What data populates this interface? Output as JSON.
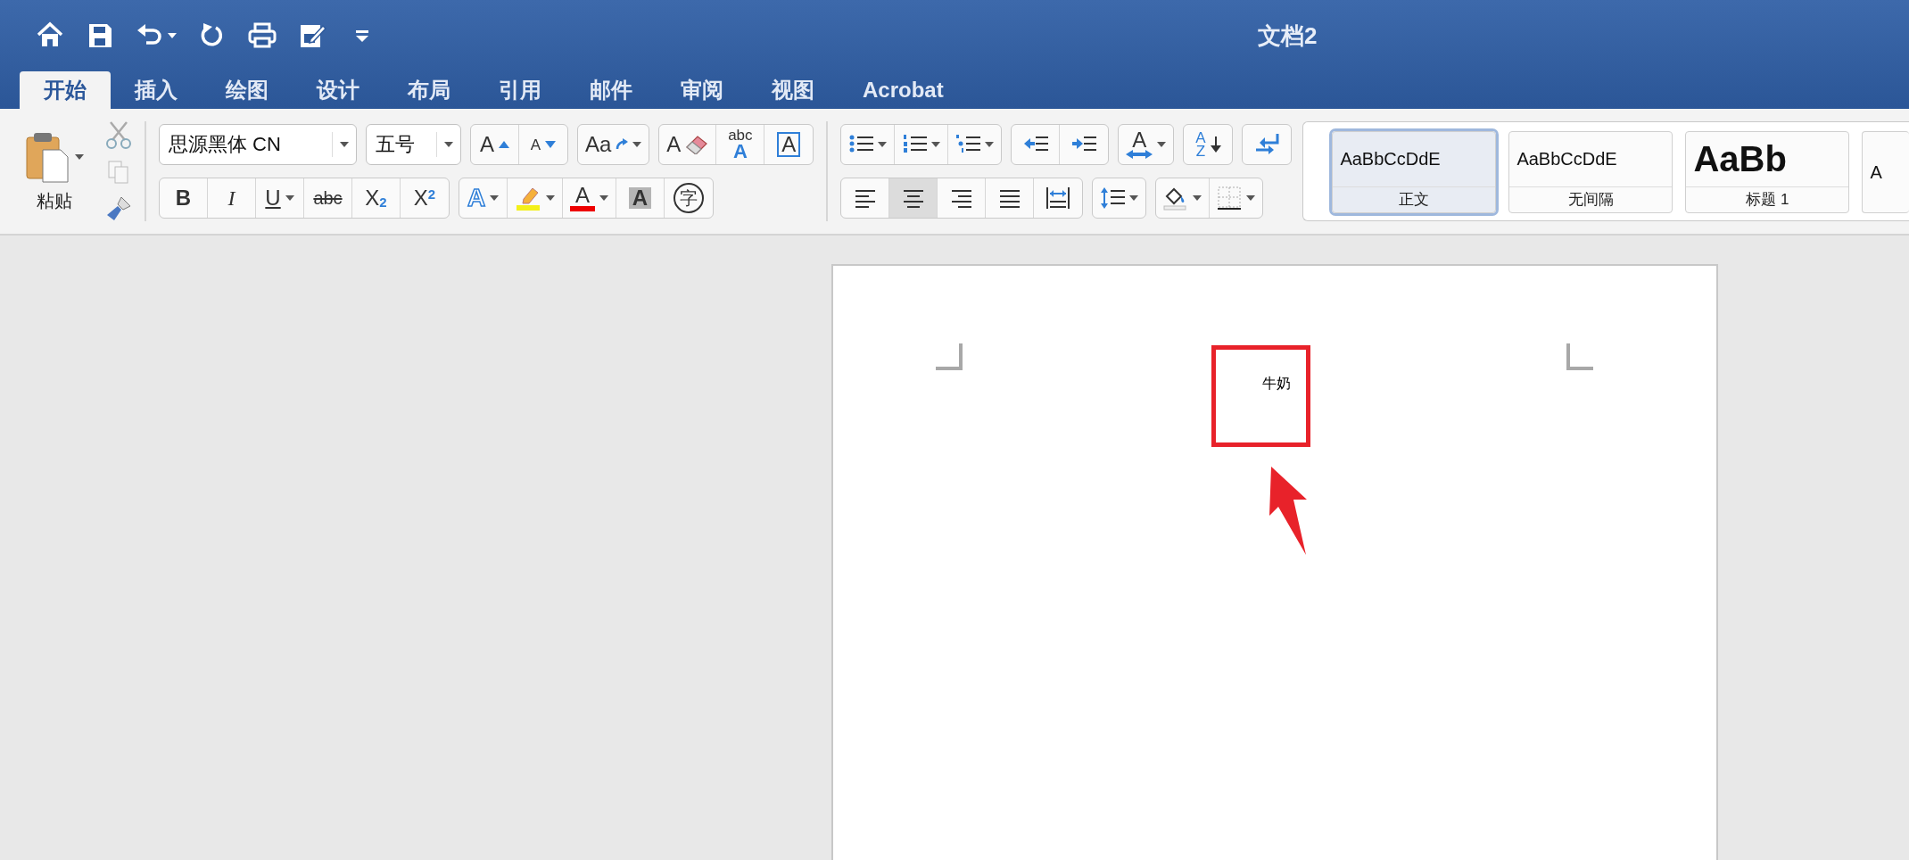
{
  "window": {
    "title": "文档2"
  },
  "quick_access": [
    {
      "kind": "home"
    },
    {
      "kind": "save"
    },
    {
      "kind": "undo",
      "dropdown": true
    },
    {
      "kind": "redo"
    },
    {
      "kind": "print"
    },
    {
      "kind": "edit-document"
    },
    {
      "kind": "customize"
    }
  ],
  "tabs": [
    {
      "label": "开始",
      "selected": true
    },
    {
      "label": "插入",
      "selected": false
    },
    {
      "label": "绘图",
      "selected": false
    },
    {
      "label": "设计",
      "selected": false
    },
    {
      "label": "布局",
      "selected": false
    },
    {
      "label": "引用",
      "selected": false
    },
    {
      "label": "邮件",
      "selected": false
    },
    {
      "label": "审阅",
      "selected": false
    },
    {
      "label": "视图",
      "selected": false
    },
    {
      "label": "Acrobat",
      "selected": false
    }
  ],
  "clipboard": {
    "paste_label": "粘贴"
  },
  "font": {
    "family": "思源黑体 CN",
    "size": "五号",
    "row1": [
      [
        {
          "kind": "grow",
          "label": "A"
        },
        {
          "kind": "shrink",
          "label": "A"
        }
      ],
      [
        {
          "kind": "change-case",
          "label": "Aa",
          "dropdown": true
        }
      ],
      [
        {
          "kind": "clear",
          "label": "A"
        },
        {
          "kind": "phonetic",
          "label": "abc",
          "index": "A"
        },
        {
          "kind": "border",
          "label": "A"
        }
      ]
    ],
    "row2": [
      [
        {
          "kind": "bold",
          "label": "B"
        },
        {
          "kind": "italic",
          "label": "I"
        },
        {
          "kind": "underline",
          "label": "U",
          "dropdown": true
        },
        {
          "kind": "strike",
          "label": "abc"
        },
        {
          "kind": "subscript",
          "label": "X",
          "index": "2"
        },
        {
          "kind": "superscript",
          "label": "X",
          "index": "2"
        }
      ],
      [
        {
          "kind": "effects",
          "label": "A",
          "dropdown": true
        },
        {
          "kind": "highlight",
          "dropdown": true
        },
        {
          "kind": "font-color",
          "label": "A",
          "dropdown": true
        },
        {
          "kind": "shading",
          "label": "A"
        },
        {
          "kind": "enclose",
          "label": "字"
        }
      ]
    ]
  },
  "paragraph": {
    "row1": [
      [
        {
          "kind": "bullets",
          "dropdown": true
        },
        {
          "kind": "numbering",
          "dropdown": true
        },
        {
          "kind": "multilevel",
          "dropdown": true
        }
      ],
      [
        {
          "kind": "outdent"
        },
        {
          "kind": "indent"
        }
      ],
      [
        {
          "kind": "text-direction",
          "label": "A",
          "dropdown": true
        }
      ],
      [
        {
          "kind": "sort",
          "label": "A",
          "index": "Z"
        }
      ],
      [
        {
          "kind": "paragraph-direction"
        }
      ]
    ],
    "row2": [
      [
        {
          "kind": "align-left",
          "selected": false
        },
        {
          "kind": "align-center",
          "selected": true
        },
        {
          "kind": "align-right",
          "selected": false
        },
        {
          "kind": "justify",
          "selected": false
        },
        {
          "kind": "distributed",
          "selected": false
        }
      ],
      [
        {
          "kind": "line-spacing",
          "dropdown": true
        }
      ],
      [
        {
          "kind": "fill",
          "dropdown": true
        },
        {
          "kind": "borders",
          "dropdown": true
        }
      ]
    ]
  },
  "styles": [
    {
      "preview": "AaBbCcDdE",
      "name": "正文",
      "kind": "normal",
      "selected": true
    },
    {
      "preview": "AaBbCcDdE",
      "name": "无间隔",
      "kind": "normal",
      "selected": false
    },
    {
      "preview": "AaBb",
      "name": "标题 1",
      "kind": "heading",
      "selected": false
    },
    {
      "preview": "A",
      "kind": "normal",
      "selected": false
    }
  ],
  "document": {
    "text": "牛奶"
  }
}
